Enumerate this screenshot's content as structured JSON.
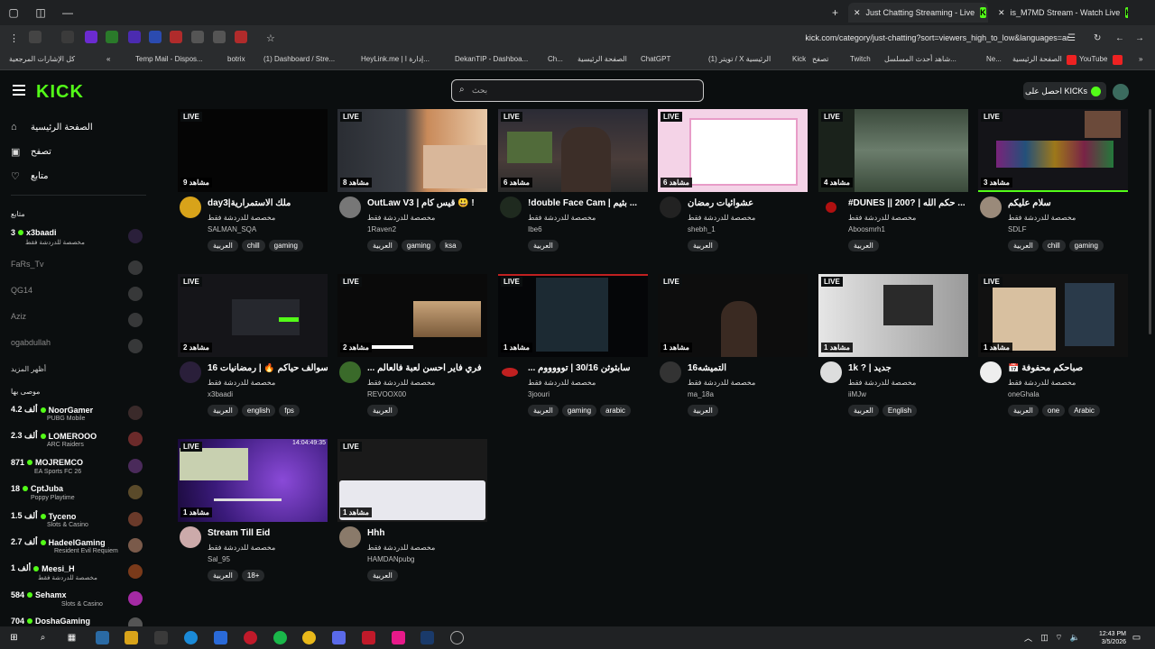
{
  "browser": {
    "tabs": [
      {
        "label": "Just Chatting Streaming - Live"
      },
      {
        "label": "is_M7MD Stream - Watch Live"
      }
    ],
    "url": "kick.com/category/just-chatting?sort=viewers_high_to_low&languages=ar",
    "bookmarks": [
      "كل الإشارات المرجعية",
      "Temp Mail - Dispos...",
      "botrix",
      "(1) Dashboard / Stre...",
      "HeyLink.me | إدارة ا...",
      "DekanTIP - Dashboa...",
      "Ch...",
      "الصفحة الرئيسية",
      "ChatGPT",
      "(1) تويتر / X الرئيسية",
      "Kick",
      "تصفح",
      "Twitch",
      "شاهد أحدث المسلسل...",
      "Ne...",
      "الصفحة الرئيسية",
      "YouTube"
    ]
  },
  "header": {
    "logo": "KICK",
    "search_placeholder": "بحث",
    "get_kicks": "احصل على KICKs"
  },
  "sidebar": {
    "nav": [
      {
        "label": "الصفحة الرئيسية",
        "icon": "home-icon"
      },
      {
        "label": "تصفح",
        "icon": "browse-icon"
      },
      {
        "label": "متابع",
        "icon": "heart-icon"
      }
    ],
    "following_title": "متابع",
    "following": [
      {
        "name": "x3baadi",
        "count": "3",
        "sub": "مخصصة للدردشة فقط",
        "online": true
      },
      {
        "name": "FaRs_Tv",
        "count": "",
        "sub": "",
        "online": false
      },
      {
        "name": "QG14",
        "count": "",
        "sub": "",
        "online": false
      },
      {
        "name": "Aziz",
        "count": "",
        "sub": "",
        "online": false
      },
      {
        "name": "ogabdullah",
        "count": "",
        "sub": "",
        "online": false
      }
    ],
    "show_more": "أظهر المزيد",
    "recommended_title": "موصى بها",
    "recommended": [
      {
        "name": "NoorGamer",
        "count": "4.2 ألف",
        "sub": "PUBG Mobile"
      },
      {
        "name": "LOMEROOO",
        "count": "2.3 ألف",
        "sub": "ARC Raiders"
      },
      {
        "name": "MOJREMCO",
        "count": "871",
        "sub": "EA Sports FC 26"
      },
      {
        "name": "CptJuba",
        "count": "18",
        "sub": "Poppy Playtime"
      },
      {
        "name": "Tyceno",
        "count": "1.5 ألف",
        "sub": "Slots & Casino"
      },
      {
        "name": "HadeelGaming",
        "count": "2.7 ألف",
        "sub": "Resident Evil Requiem"
      },
      {
        "name": "Meesi_H",
        "count": "1 ألف",
        "sub": "مخصصة للدردشة فقط"
      },
      {
        "name": "Sehamx",
        "count": "584",
        "sub": "Slots & Casino"
      },
      {
        "name": "DoshaGaming",
        "count": "704",
        "sub": ""
      }
    ]
  },
  "cards": [
    {
      "live": "LIVE",
      "viewers": "9 مشاهد",
      "title": "day3|ملك الاستمرارية",
      "category": "مخصصة للدردشة فقط",
      "streamer": "SALMAN_SQA",
      "tags": [
        "العربية",
        "chill",
        "gaming"
      ]
    },
    {
      "live": "LIVE",
      "viewers": "8 مشاهد",
      "title": "OutLaw V3 | قيس كام 😃 !",
      "category": "مخصصة للدردشة فقط",
      "streamer": "1Raven2",
      "tags": [
        "العربية",
        "gaming",
        "ksa"
      ]
    },
    {
      "live": "LIVE",
      "viewers": "6 مشاهد",
      "title": "!double Face Cam | بثيم ...",
      "category": "مخصصة للدردشة فقط",
      "streamer": "Ibe6",
      "tags": [
        "العربية"
      ]
    },
    {
      "live": "LIVE",
      "viewers": "6 مشاهد",
      "title": "عشوائيات رمضان",
      "category": "مخصصة للدردشة فقط",
      "streamer": "shebh_1",
      "tags": [
        "العربية"
      ]
    },
    {
      "live": "LIVE",
      "viewers": "4 مشاهد",
      "title": "#DUNES || 200? | حكم الله ...",
      "category": "مخصصة للدردشة فقط",
      "streamer": "Aboosmrh1",
      "tags": [
        "العربية"
      ]
    },
    {
      "live": "LIVE",
      "viewers": "3 مشاهد",
      "title": "سلام عليكم",
      "category": "مخصصة للدردشة فقط",
      "streamer": "SDLF",
      "tags": [
        "العربية",
        "chill",
        "gaming"
      ]
    },
    {
      "live": "LIVE",
      "viewers": "2 مشاهد",
      "title": "سوالف حياكم 🔥 | رمضانيات 16",
      "category": "مخصصة للدردشة فقط",
      "streamer": "x3baadi",
      "tags": [
        "العربية",
        "english",
        "fps"
      ]
    },
    {
      "live": "LIVE",
      "viewers": "2 مشاهد",
      "title": "... فري فاير احسن لعبة فالعالم",
      "category": "مخصصة للدردشة فقط",
      "streamer": "REVOOX00",
      "tags": [
        "العربية"
      ]
    },
    {
      "live": "LIVE",
      "viewers": "1 مشاهد",
      "title": "... سابثوثن 30/16 | توووووم",
      "category": "مخصصة للدردشة فقط",
      "streamer": "3joouri",
      "tags": [
        "العربية",
        "gaming",
        "arabic"
      ]
    },
    {
      "live": "LIVE",
      "viewers": "1 مشاهد",
      "title": "التميشه16",
      "category": "مخصصة للدردشة فقط",
      "streamer": "ma_18a",
      "tags": [
        "العربية"
      ]
    },
    {
      "live": "LIVE",
      "viewers": "1 مشاهد",
      "title": "1k ? | جديد",
      "category": "مخصصة للدردشة فقط",
      "streamer": "iiMJw",
      "tags": [
        "العربية",
        "English"
      ]
    },
    {
      "live": "LIVE",
      "viewers": "1 مشاهد",
      "title": "📅 صباحكم محفوفة",
      "category": "مخصصة للدردشة فقط",
      "streamer": "oneGhala",
      "tags": [
        "العربية",
        "one",
        "Arabic"
      ]
    },
    {
      "live": "LIVE",
      "viewers": "1 مشاهد",
      "title": "Stream Till Eid",
      "category": "مخصصة للدردشة فقط",
      "streamer": "Sal_95",
      "tags": [
        "العربية",
        "18+"
      ],
      "overlay": "14:04:49:35"
    },
    {
      "live": "LIVE",
      "viewers": "1 مشاهد",
      "title": "Hhh",
      "category": "مخصصة للدردشة فقط",
      "streamer": "HAMDANpubg",
      "tags": [
        "العربية"
      ]
    }
  ],
  "taskbar": {
    "time": "12:43 PM",
    "date": "3/5/2026"
  }
}
